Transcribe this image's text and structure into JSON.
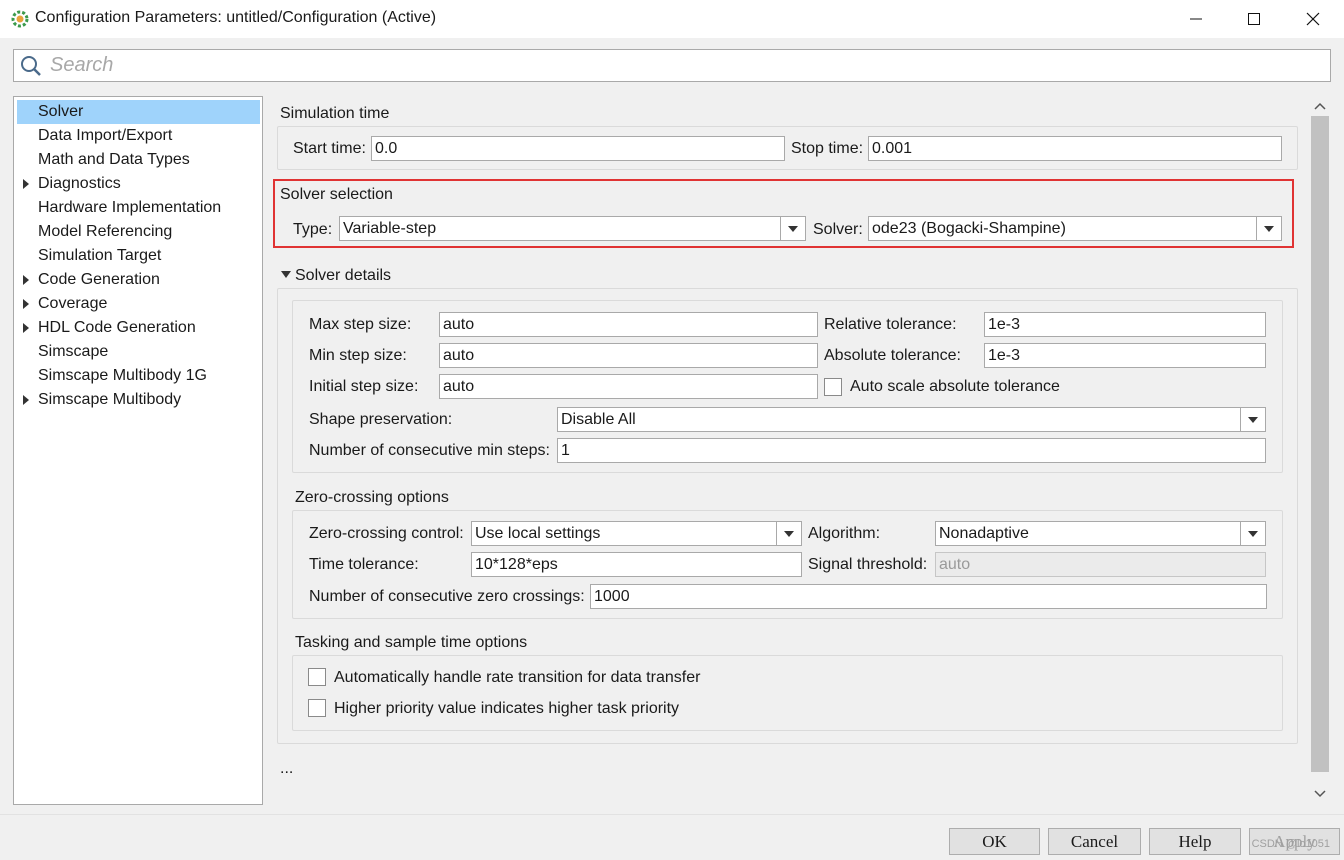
{
  "window": {
    "title": "Configuration Parameters: untitled/Configuration (Active)",
    "minimize_glyph": "—",
    "maximize_glyph": "☐",
    "close_glyph": "✕"
  },
  "search": {
    "placeholder": "Search"
  },
  "nav": {
    "items": [
      {
        "label": "Solver",
        "expandable": false,
        "selected": true
      },
      {
        "label": "Data Import/Export",
        "expandable": false
      },
      {
        "label": "Math and Data Types",
        "expandable": false
      },
      {
        "label": "Diagnostics",
        "expandable": true
      },
      {
        "label": "Hardware Implementation",
        "expandable": false
      },
      {
        "label": "Model Referencing",
        "expandable": false
      },
      {
        "label": "Simulation Target",
        "expandable": false
      },
      {
        "label": "Code Generation",
        "expandable": true
      },
      {
        "label": "Coverage",
        "expandable": true
      },
      {
        "label": "HDL Code Generation",
        "expandable": true
      },
      {
        "label": "Simscape",
        "expandable": false
      },
      {
        "label": "Simscape Multibody 1G",
        "expandable": false
      },
      {
        "label": "Simscape Multibody",
        "expandable": true
      }
    ]
  },
  "simulation_time": {
    "title": "Simulation time",
    "start_label": "Start time:",
    "start_value": "0.0",
    "stop_label": "Stop time:",
    "stop_value": "0.001"
  },
  "solver_selection": {
    "title": "Solver selection",
    "type_label": "Type:",
    "type_value": "Variable-step",
    "solver_label": "Solver:",
    "solver_value": "ode23 (Bogacki-Shampine)"
  },
  "solver_details": {
    "title": "Solver details",
    "max_step_label": "Max step size:",
    "max_step_value": "auto",
    "min_step_label": "Min step size:",
    "min_step_value": "auto",
    "initial_step_label": "Initial step size:",
    "initial_step_value": "auto",
    "rel_tol_label": "Relative tolerance:",
    "rel_tol_value": "1e-3",
    "abs_tol_label": "Absolute tolerance:",
    "abs_tol_value": "1e-3",
    "auto_scale_label": "Auto scale absolute tolerance",
    "shape_label": "Shape preservation:",
    "shape_value": "Disable All",
    "consec_min_label": "Number of consecutive min steps:",
    "consec_min_value": "1"
  },
  "zero_crossing": {
    "title": "Zero-crossing options",
    "control_label": "Zero-crossing control:",
    "control_value": "Use local settings",
    "algorithm_label": "Algorithm:",
    "algorithm_value": "Nonadaptive",
    "time_tol_label": "Time tolerance:",
    "time_tol_value": "10*128*eps",
    "signal_label": "Signal threshold:",
    "signal_value": "auto",
    "consec_zero_label": "Number of consecutive zero crossings:",
    "consec_zero_value": "1000"
  },
  "tasking": {
    "title": "Tasking and sample time options",
    "rate_transition_label": "Automatically handle rate transition for data transfer",
    "priority_label": "Higher priority value indicates higher task priority"
  },
  "more_ellipsis": "...",
  "buttons": {
    "ok": "OK",
    "cancel": "Cancel",
    "help": "Help",
    "apply": "Apply"
  },
  "watermark": "CSDN @lo1051",
  "colors": {
    "selection": "#9fd3fb",
    "highlight_box": "#e03333"
  }
}
